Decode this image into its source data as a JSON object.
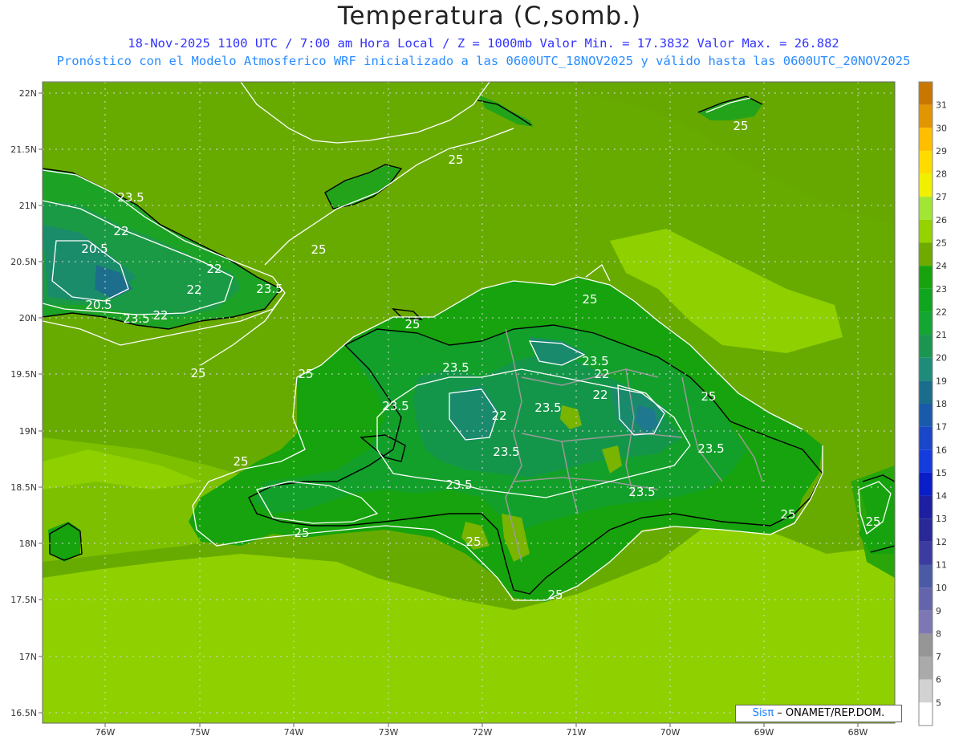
{
  "title": "Temperatura (C,somb.)",
  "subtitle1": "18-Nov-2025  1100 UTC / 7:00 am Hora Local / Z = 1000mb    Valor Min. = 17.3832  Valor Max. = 26.882",
  "subtitle2": "Pronóstico con el Modelo Atmosferico WRF inicializado a las 0600UTC_18NOV2025 y válido hasta las  0600UTC_20NOV2025",
  "credit": {
    "logo": "Sisπ",
    "text": " – ONAMET/REP.DOM."
  },
  "lat_labels": [
    "22N",
    "21.5N",
    "21N",
    "20.5N",
    "20N",
    "19.5N",
    "19N",
    "18.5N",
    "18N",
    "17.5N",
    "17N",
    "16.5N"
  ],
  "lon_labels": [
    "76W",
    "75W",
    "74W",
    "73W",
    "72W",
    "71W",
    "70W",
    "69W",
    "68W"
  ],
  "contour_labels": [
    "23.5",
    "22",
    "20.5",
    "22",
    "23.5",
    "22",
    "20.5",
    "23.5",
    "22",
    "25",
    "25",
    "25",
    "25",
    "25",
    "25",
    "23.5",
    "22",
    "22",
    "23.5",
    "22",
    "23.5",
    "23.5",
    "23.5",
    "23.5",
    "25",
    "25",
    "23.5",
    "25",
    "25",
    "25",
    "25",
    "23.5",
    "25",
    "25"
  ],
  "colorbar": {
    "labels": [
      "31",
      "30",
      "29",
      "28",
      "27",
      "26",
      "25",
      "24",
      "23",
      "22",
      "21",
      "20",
      "19",
      "18",
      "17",
      "16",
      "15",
      "14",
      "13",
      "12",
      "11",
      "10",
      "9",
      "8",
      "7",
      "6",
      "5"
    ],
    "colors": [
      "#c87800",
      "#e09600",
      "#ffbe00",
      "#ffdc00",
      "#f0f000",
      "#a0e632",
      "#96d200",
      "#6eaa00",
      "#16a30d",
      "#0fa51e",
      "#14a532",
      "#1a9650",
      "#1e8c78",
      "#1a6e8c",
      "#1a5aaa",
      "#1a46c8",
      "#143cdc",
      "#0a1ec8",
      "#1e1ea0",
      "#282896",
      "#3c3ca0",
      "#4b5aa5",
      "#6464aa",
      "#7d78b4",
      "#969696",
      "#aaaaaa",
      "#d2d2d2",
      "#ffffff"
    ]
  }
}
